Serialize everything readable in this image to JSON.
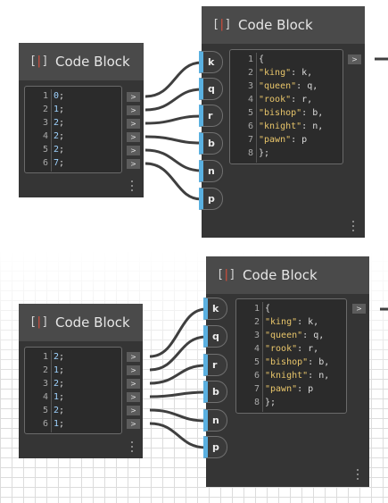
{
  "colors": {
    "node_body": "#353535",
    "node_header": "#4a4a4a",
    "editor_bg": "#2b2b2b",
    "input_port_accent": "#5ab0e0",
    "icon_bracket_accent": "#d94e3b",
    "number_text": "#9fd3ff",
    "string_text": "#e8c56a",
    "wire": "#3f3f3f",
    "grid_line": "#dcdcdc"
  },
  "icons": {
    "code_block": "code-block-icon",
    "output_port": "chevron-right-icon",
    "resize": "vertical-dots-icon"
  },
  "graphs": [
    {
      "list_node": {
        "title": "Code Block",
        "icon_text": "[ ]",
        "lines": [
          {
            "n": "1",
            "v": "0",
            "t": ";"
          },
          {
            "n": "2",
            "v": "1",
            "t": ";"
          },
          {
            "n": "3",
            "v": "2",
            "t": ";"
          },
          {
            "n": "4",
            "v": "2",
            "t": ";"
          },
          {
            "n": "5",
            "v": "2",
            "t": ";"
          },
          {
            "n": "6",
            "v": "7",
            "t": ";"
          }
        ],
        "output_label": ">"
      },
      "dict_node": {
        "title": "Code Block",
        "icon_text": "[ ]",
        "inputs": [
          "k",
          "q",
          "r",
          "b",
          "n",
          "p"
        ],
        "output_label": ">",
        "lines": [
          {
            "n": "1",
            "text": "{"
          },
          {
            "n": "2",
            "key": "\"king\"",
            "val": ": k,"
          },
          {
            "n": "3",
            "key": "\"queen\"",
            "val": ": q,"
          },
          {
            "n": "4",
            "key": "\"rook\"",
            "val": ": r,"
          },
          {
            "n": "5",
            "key": "\"bishop\"",
            "val": ": b,"
          },
          {
            "n": "6",
            "key": "\"knight\"",
            "val": ": n,"
          },
          {
            "n": "7",
            "key": "\"pawn\"",
            "val": ": p"
          },
          {
            "n": "8",
            "text": "};"
          }
        ]
      }
    },
    {
      "list_node": {
        "title": "Code Block",
        "icon_text": "[ ]",
        "lines": [
          {
            "n": "1",
            "v": "2",
            "t": ";"
          },
          {
            "n": "2",
            "v": "1",
            "t": ";"
          },
          {
            "n": "3",
            "v": "2",
            "t": ";"
          },
          {
            "n": "4",
            "v": "1",
            "t": ";"
          },
          {
            "n": "5",
            "v": "2",
            "t": ";"
          },
          {
            "n": "6",
            "v": "1",
            "t": ";"
          }
        ],
        "output_label": ">"
      },
      "dict_node": {
        "title": "Code Block",
        "icon_text": "[ ]",
        "inputs": [
          "k",
          "q",
          "r",
          "b",
          "n",
          "p"
        ],
        "output_label": ">",
        "lines": [
          {
            "n": "1",
            "text": "{"
          },
          {
            "n": "2",
            "key": "\"king\"",
            "val": ": k,"
          },
          {
            "n": "3",
            "key": "\"queen\"",
            "val": ": q,"
          },
          {
            "n": "4",
            "key": "\"rook\"",
            "val": ": r,"
          },
          {
            "n": "5",
            "key": "\"bishop\"",
            "val": ": b,"
          },
          {
            "n": "6",
            "key": "\"knight\"",
            "val": ": n,"
          },
          {
            "n": "7",
            "key": "\"pawn\"",
            "val": ": p"
          },
          {
            "n": "8",
            "text": "};"
          }
        ]
      }
    }
  ]
}
